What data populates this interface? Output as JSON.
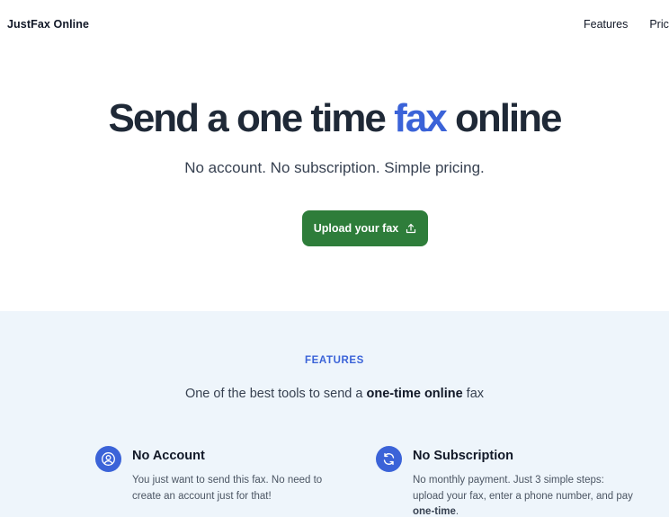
{
  "header": {
    "brand": "JustFax Online",
    "nav": {
      "features": "Features",
      "pricing": "Prici"
    }
  },
  "hero": {
    "title_before": "Send a one time ",
    "title_accent": "fax",
    "title_after": " online",
    "subtitle": "No account. No subscription. Simple pricing.",
    "cta_label": "Upload your fax"
  },
  "features": {
    "eyebrow": "FEATURES",
    "heading_before": "One of the best tools to send a ",
    "heading_bold": "one-time online",
    "heading_after": " fax",
    "items": [
      {
        "icon": "user-circle-icon",
        "title": "No Account",
        "desc": "You just want to send this fax. No need to create an account just for that!"
      },
      {
        "icon": "refresh-icon",
        "title": "No Subscription",
        "desc_before": "No monthly payment. Just 3 simple steps: upload your fax, enter a phone number, and pay ",
        "desc_bold": "one-time",
        "desc_after": "."
      }
    ]
  },
  "colors": {
    "accent_blue": "#3b63d8",
    "cta_green": "#2e7d3a",
    "features_bg": "#eef5fb"
  }
}
